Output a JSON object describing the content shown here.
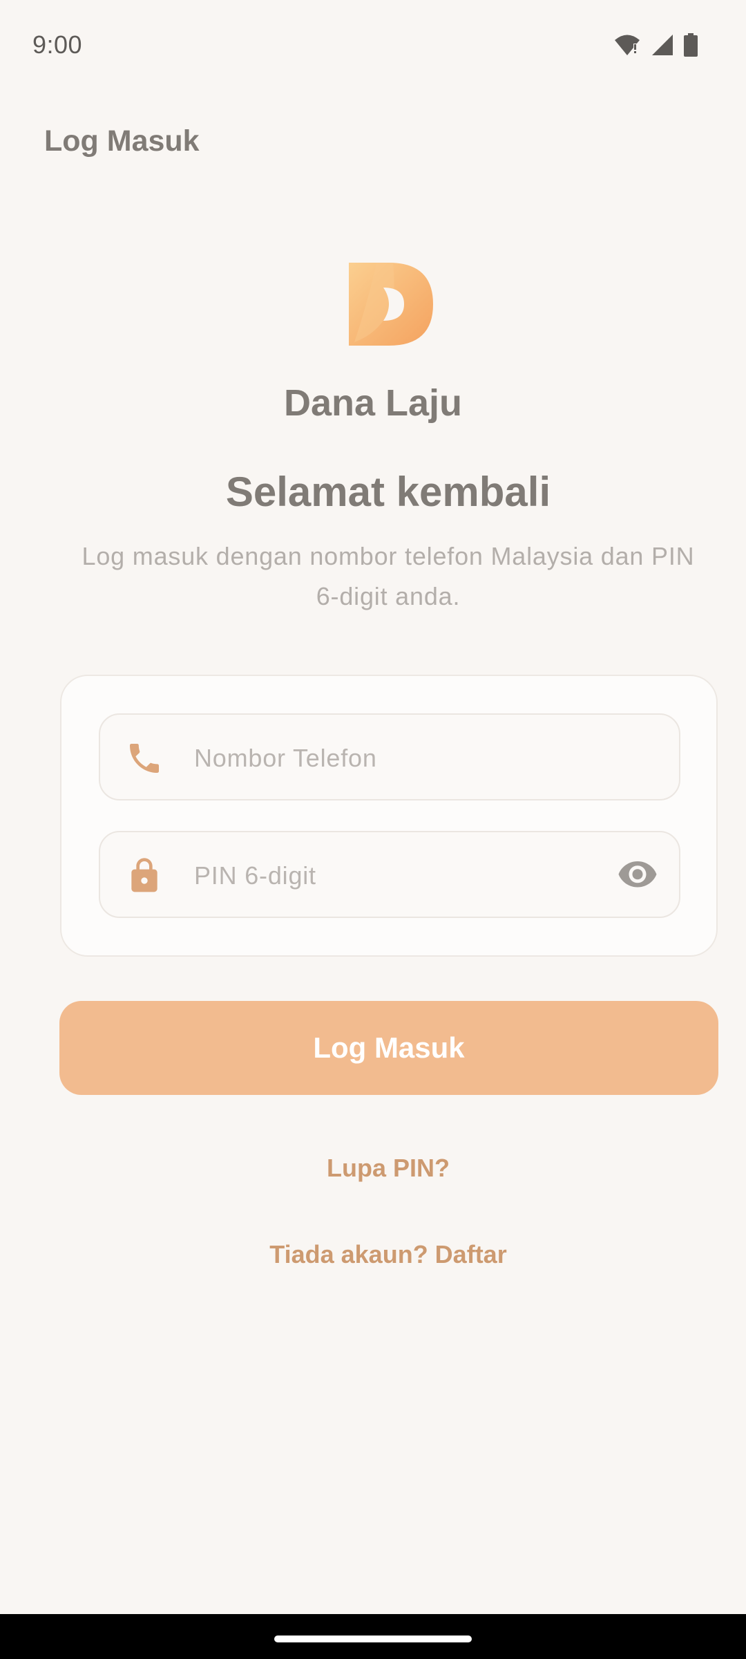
{
  "status_bar": {
    "time": "9:00",
    "icons": [
      "wifi-alert-icon",
      "cellular-signal-icon",
      "battery-icon"
    ]
  },
  "app_bar": {
    "title": "Log Masuk"
  },
  "brand": {
    "name": "Dana Laju",
    "logo_icon": "dana-laju-logo"
  },
  "welcome": {
    "title": "Selamat kembali",
    "subtitle": "Log masuk dengan nombor telefon Malaysia dan PIN 6-digit anda."
  },
  "form": {
    "phone": {
      "placeholder": "Nombor Telefon",
      "value": "",
      "icon": "phone-icon"
    },
    "pin": {
      "placeholder": "PIN 6-digit",
      "value": "",
      "icon": "lock-icon",
      "toggle_icon": "eye-icon"
    }
  },
  "actions": {
    "login_label": "Log Masuk",
    "forgot_pin_label": "Lupa PIN?",
    "register_label": "Tiada akaun? Daftar"
  },
  "colors": {
    "background": "#f9f6f3",
    "accent": "#f2bb8f",
    "link": "#cd9a70",
    "icon": "#dca57a"
  }
}
